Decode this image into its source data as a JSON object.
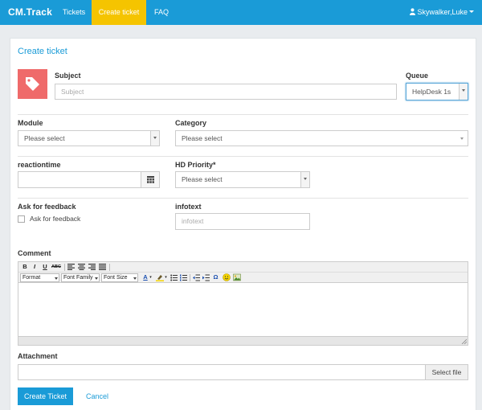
{
  "navbar": {
    "brand": "CM.Track",
    "links": [
      {
        "label": "Tickets",
        "active": false
      },
      {
        "label": "Create ticket",
        "active": true
      },
      {
        "label": "FAQ",
        "active": false
      }
    ],
    "user": "Skywalker,Luke"
  },
  "form": {
    "title": "Create ticket",
    "subject": {
      "label": "Subject",
      "placeholder": "Subject"
    },
    "queue": {
      "label": "Queue",
      "value": "HelpDesk 1s"
    },
    "module": {
      "label": "Module",
      "value": "Please select"
    },
    "category": {
      "label": "Category",
      "value": "Please select"
    },
    "reactiontime": {
      "label": "reactiontime",
      "value": ""
    },
    "hd_priority": {
      "label": "HD Priority*",
      "value": "Please select"
    },
    "feedback": {
      "label": "Ask for feedback",
      "checkbox_label": "Ask for feedback",
      "checked": false
    },
    "infotext": {
      "label": "infotext",
      "placeholder": "infotext"
    },
    "comment": {
      "label": "Comment",
      "toolbar": {
        "format": "Format",
        "font_family": "Font Family",
        "font_size": "Font Size"
      }
    },
    "attachment": {
      "label": "Attachment",
      "button": "Select file"
    },
    "actions": {
      "submit": "Create Ticket",
      "cancel": "Cancel"
    }
  },
  "colors": {
    "primary": "#1a9bd7",
    "active_tab": "#f5c400",
    "ticket_icon_bg": "#ef6a6a"
  }
}
